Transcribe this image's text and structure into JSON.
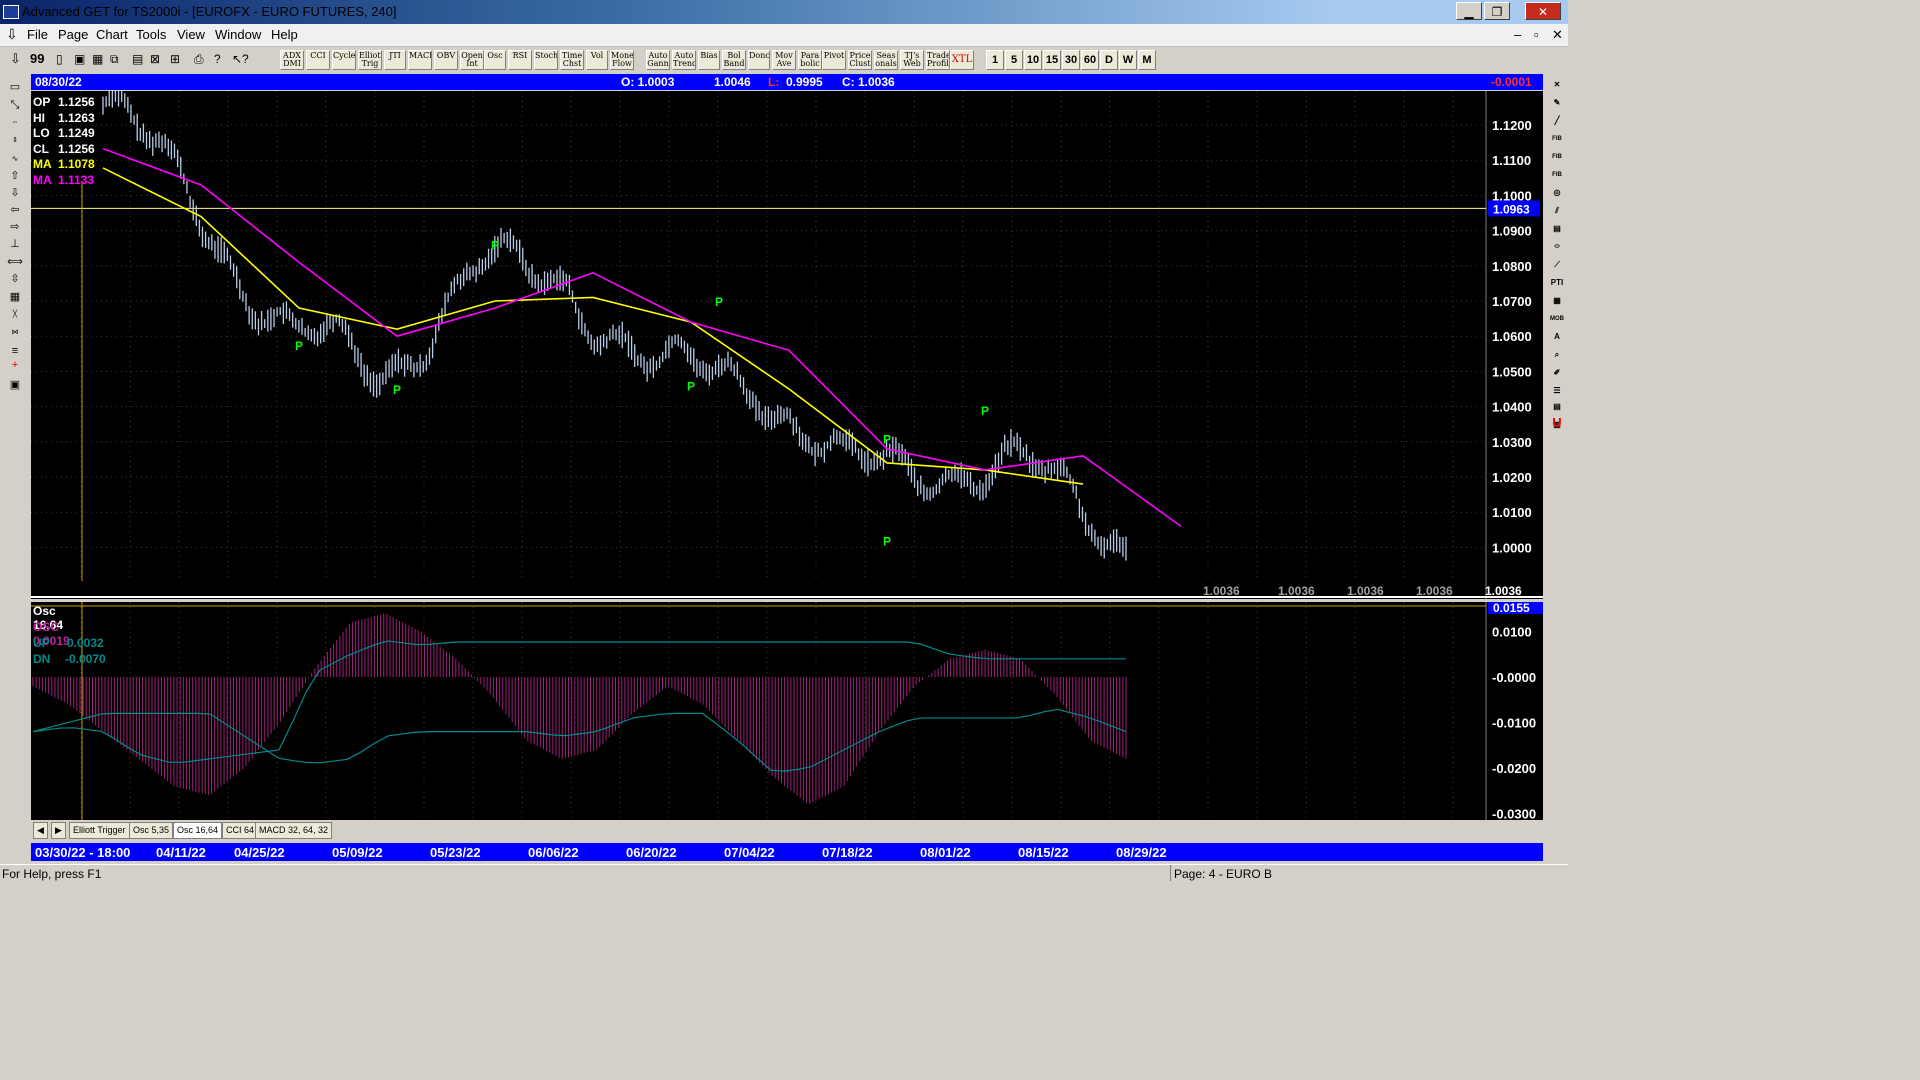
{
  "window": {
    "title": "Advanced GET for TS2000i - [EUROFX - EURO FUTURES, 240]",
    "minimize": "▁",
    "maximize": "❐",
    "close": "✕"
  },
  "menu": [
    "File",
    "Page",
    "Chart",
    "Tools",
    "View",
    "Window",
    "Help"
  ],
  "mdi_controls": [
    "–",
    "▫",
    "✕"
  ],
  "toolbar": {
    "buttons": [
      "ADX DMI",
      "CCI",
      "Cycles",
      "Elliott Trig",
      "JTI",
      "MACD",
      "OBV",
      "Open Int",
      "Osc",
      "RSI",
      "Stoch",
      "Time Chst",
      "Vol",
      "Money Flow",
      "Auto Gann",
      "Auto Trend",
      "Bias",
      "Bol Band",
      "Donch",
      "Mov Ave",
      "Para bolic",
      "Pivot",
      "Price Clust",
      "Seas onals",
      "TJ's Web",
      "Trade Profile",
      "XTL"
    ],
    "timeframes": [
      "1",
      "5",
      "10",
      "15",
      "30",
      "60",
      "D",
      "W",
      "M"
    ]
  },
  "infobar": {
    "date": "08/30/22",
    "open": "O: 1.0003",
    "high": "1.0046",
    "low_label": "L:",
    "low": "0.9995",
    "close": "C: 1.0036",
    "change": "-0.0001"
  },
  "price_legend": [
    {
      "label": "OP",
      "value": "1.1256",
      "color": "#ffffff"
    },
    {
      "label": "HI",
      "value": "1.1263",
      "color": "#ffffff"
    },
    {
      "label": "LO",
      "value": "1.1249",
      "color": "#ffffff"
    },
    {
      "label": "CL",
      "value": "1.1256",
      "color": "#ffffff"
    },
    {
      "label": "MA",
      "value": "1.1078",
      "color": "#ffff00"
    },
    {
      "label": "MA",
      "value": "1.1133",
      "color": "#ff00ff"
    }
  ],
  "price_axis": [
    "1.1200",
    "1.1100",
    "1.1000",
    "1.0900",
    "1.0800",
    "1.0700",
    "1.0600",
    "1.0500",
    "1.0400",
    "1.0300",
    "1.0200",
    "1.0100",
    "1.0000"
  ],
  "price_marker": "1.0963",
  "bottom_values": [
    "1.0036",
    "1.0036",
    "1.0036",
    "1.0036",
    "1.0036"
  ],
  "pivot_label": "P",
  "osc_legend": {
    "title": "Osc 16,64",
    "osc": "OSC 0.0019",
    "up_label": "UP",
    "up": "0.0032",
    "dn_label": "DN",
    "dn": "-0.0070"
  },
  "osc_axis": [
    "0.0100",
    "-0.0000",
    "-0.0100",
    "-0.0200",
    "-0.0300"
  ],
  "osc_marker": "0.0155",
  "tabs": [
    "Elliott Trigger",
    "Osc 5,35",
    "Osc 16,64",
    "CCI 64",
    "MACD 32, 64, 32"
  ],
  "tab_nav": [
    "◀",
    "▶"
  ],
  "dates": [
    "03/30/22 - 18:00",
    "04/11/22",
    "04/25/22",
    "05/09/22",
    "05/23/22",
    "06/06/22",
    "06/20/22",
    "07/04/22",
    "07/18/22",
    "08/01/22",
    "08/15/22",
    "08/29/22"
  ],
  "status": {
    "help": "For Help, press F1",
    "page": "Page: 4 - EURO B"
  },
  "colors": {
    "price_bars": "#b8cce8",
    "ma_fast": "#ffff00",
    "ma_slow": "#ff00ff",
    "pivot": "#00ff00",
    "osc_hist": "#a0207a",
    "up_line": "#008b8b",
    "dn_line": "#008b8b",
    "info_bg": "#0000ff"
  },
  "chart_data": {
    "type": "line",
    "title": "EUROFX - EURO FUTURES, 240",
    "x": [
      "03/30/22",
      "04/11/22",
      "04/25/22",
      "05/09/22",
      "05/23/22",
      "06/06/22",
      "06/20/22",
      "07/04/22",
      "07/18/22",
      "08/01/22",
      "08/15/22",
      "08/29/22"
    ],
    "series": [
      {
        "name": "price",
        "values": [
          1.1256,
          1.098,
          1.06,
          1.05,
          1.078,
          1.076,
          1.048,
          1.05,
          1.02,
          1.025,
          1.02,
          1.0036
        ]
      },
      {
        "name": "MA",
        "values": [
          1.1078,
          1.094,
          1.068,
          1.062,
          1.07,
          1.071,
          1.064,
          1.045,
          1.024,
          1.022,
          1.018,
          null
        ]
      },
      {
        "name": "MA",
        "values": [
          1.1133,
          1.103,
          1.081,
          1.06,
          1.068,
          1.078,
          1.064,
          1.056,
          1.028,
          1.022,
          1.026,
          1.006
        ]
      }
    ],
    "pivots": [
      {
        "x": "04/25/22",
        "y": 1.0575
      },
      {
        "x": "05/09/22",
        "y": 1.045
      },
      {
        "x": "05/23/22",
        "y": 1.086
      },
      {
        "x": "06/20/22",
        "y": 1.046
      },
      {
        "x": "06/20/22",
        "y": 1.07
      },
      {
        "x": "07/18/22",
        "y": 1.002
      },
      {
        "x": "07/18/22",
        "y": 1.031
      },
      {
        "x": "08/01/22",
        "y": 1.039
      }
    ],
    "ylim": [
      0.995,
      1.126
    ]
  },
  "osc_data": {
    "type": "bar",
    "values": [
      -0.002,
      -0.006,
      -0.012,
      -0.018,
      -0.024,
      -0.026,
      -0.02,
      -0.01,
      0.002,
      0.012,
      0.014,
      0.01,
      0.004,
      -0.004,
      -0.014,
      -0.018,
      -0.016,
      -0.008,
      -0.002,
      -0.006,
      -0.014,
      -0.022,
      -0.028,
      -0.024,
      -0.012,
      -0.002,
      0.004,
      0.006,
      0.004,
      -0.004,
      -0.014,
      -0.018
    ],
    "up": [
      -0.012,
      -0.011,
      -0.012,
      -0.017,
      -0.019,
      -0.018,
      -0.017,
      -0.016,
      0.001,
      0.005,
      0.008,
      0.007,
      0.0077,
      0.0077,
      0.0077,
      0.0077,
      0.0077,
      0.0077,
      0.0077,
      0.0077,
      0.0077,
      0.0077,
      0.0077,
      0.0077,
      0.0077,
      0.0077,
      0.005,
      0.004,
      0.004,
      0.004,
      0.004,
      0.004
    ],
    "dn": [
      -0.012,
      -0.01,
      -0.008,
      -0.008,
      -0.008,
      -0.008,
      -0.013,
      -0.018,
      -0.019,
      -0.018,
      -0.013,
      -0.012,
      -0.012,
      -0.012,
      -0.012,
      -0.013,
      -0.012,
      -0.009,
      -0.008,
      -0.008,
      -0.014,
      -0.021,
      -0.02,
      -0.016,
      -0.012,
      -0.009,
      -0.009,
      -0.009,
      -0.009,
      -0.007,
      -0.009,
      -0.012
    ],
    "ylim": [
      -0.033,
      0.015
    ]
  }
}
